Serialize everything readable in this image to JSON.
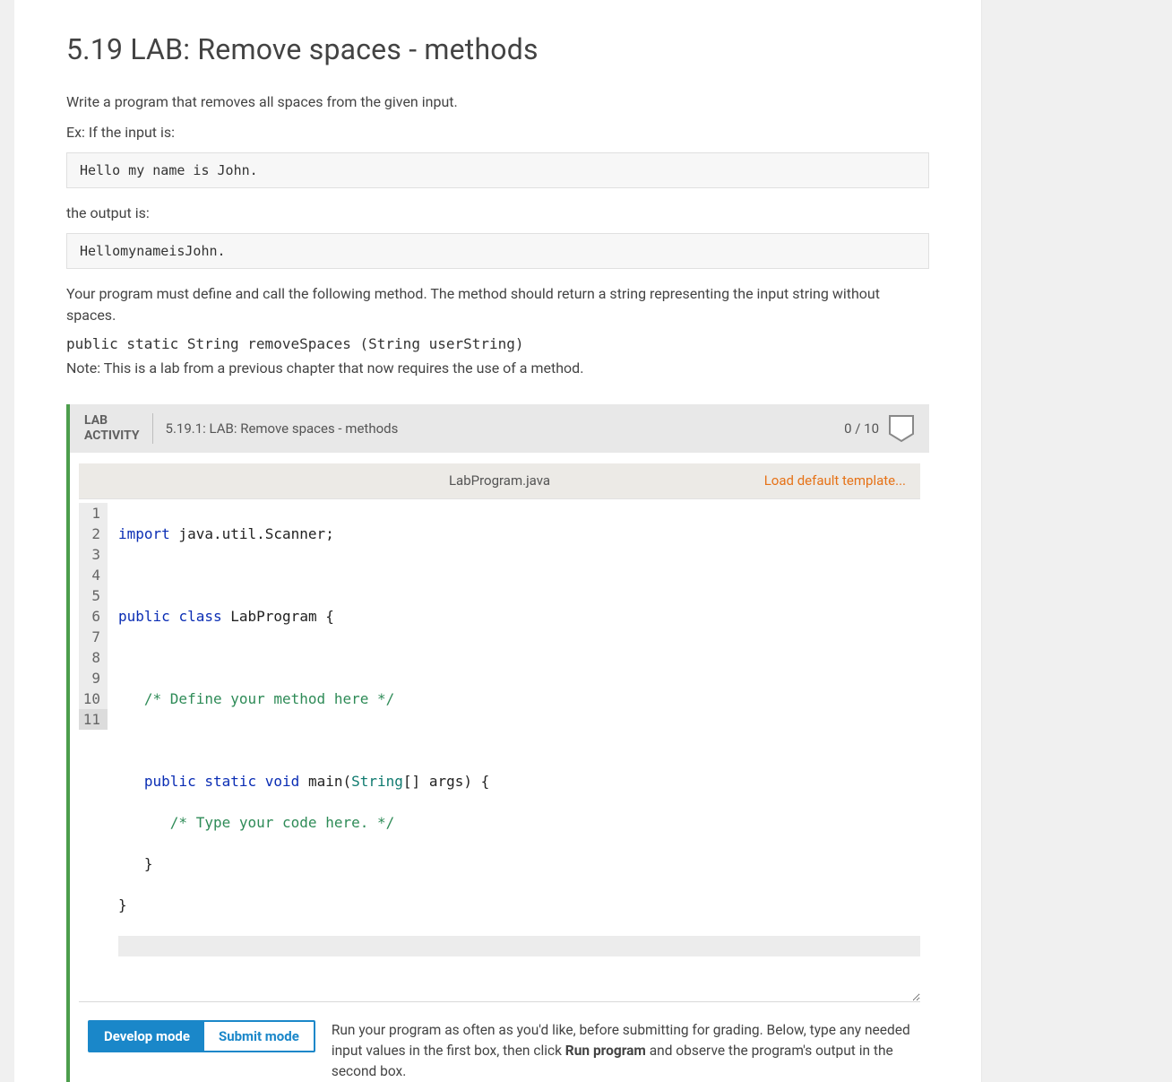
{
  "header": {
    "title": "5.19 LAB: Remove spaces - methods"
  },
  "intro": {
    "p1": "Write a program that removes all spaces from the given input.",
    "ex_label": "Ex: If the input is:",
    "input_sample": "Hello my name is John.",
    "output_label": "the output is:",
    "output_sample": "HellomynameisJohn.",
    "req_text": "Your program must define and call the following method. The method should return a string representing the input string without spaces.",
    "method_sig": "public static String removeSpaces (String userString)",
    "note": "Note: This is a lab from a previous chapter that now requires the use of a method."
  },
  "activity": {
    "badge_line1": "LAB",
    "badge_line2": "ACTIVITY",
    "title": "5.19.1: LAB: Remove spaces - methods",
    "score": "0 / 10"
  },
  "editor": {
    "filename": "LabProgram.java",
    "load_template": "Load default template...",
    "line_count": 11,
    "current_line": 11,
    "code": {
      "l1_kw": "import",
      "l1_rest": " java.util.Scanner;",
      "l3_kw1": "public",
      "l3_kw2": "class",
      "l3_name": "LabProgram",
      "l3_brace": " {",
      "l5_cm": "   /* Define your method here */",
      "l7_indent": "   ",
      "l7_kw1": "public",
      "l7_kw2": "static",
      "l7_kw3": "void",
      "l7_fn": "main",
      "l7_paren_o": "(",
      "l7_ty": "String",
      "l7_arr": "[] args) {",
      "l8_cm": "      /* Type your code here. */",
      "l9": "   }",
      "l10": "}"
    }
  },
  "modes": {
    "develop": "Develop mode",
    "submit": "Submit mode",
    "help_prefix": "Run your program as often as you'd like, before submitting for grading. Below, type any needed input values in the first box, then click ",
    "help_bold": "Run program",
    "help_suffix": " and observe the program's output in the second box."
  }
}
